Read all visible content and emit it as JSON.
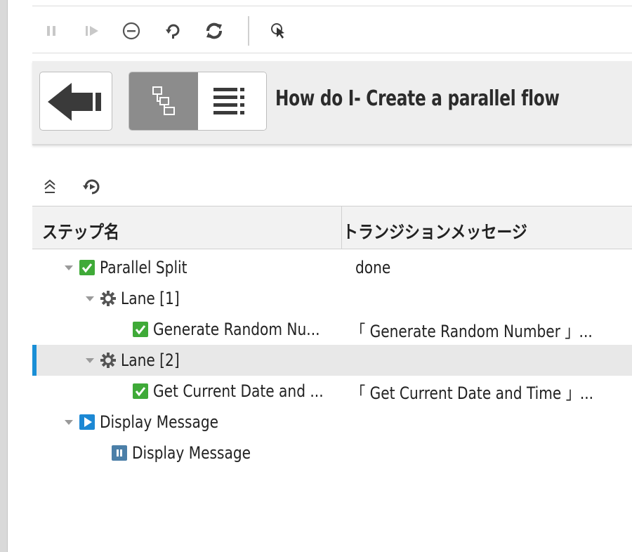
{
  "header": {
    "flow_title": "How do I- Create a parallel flow"
  },
  "toolbar": {
    "buttons": [
      "pause-icon",
      "step-forward-icon",
      "minus-circle-icon",
      "replay-icon",
      "refresh-icon",
      "pointer-icon"
    ]
  },
  "table": {
    "columns": [
      "ステップ名",
      "トランジションメッセージ"
    ],
    "rows": [
      {
        "name": "Parallel Split",
        "message": "done",
        "icon": "check-icon"
      },
      {
        "name": "Lane [1]",
        "message": "",
        "icon": "gear-icon"
      },
      {
        "name": "Generate Random Nu...",
        "message": "「 Generate Random Number 」...",
        "icon": "check-icon"
      },
      {
        "name": "Lane [2]",
        "message": "",
        "icon": "gear-icon"
      },
      {
        "name": "Get Current Date and ...",
        "message": "「 Get Current Date and Time 」...",
        "icon": "check-icon"
      },
      {
        "name": "Display Message",
        "message": "",
        "icon": "play-icon"
      },
      {
        "name": "Display Message",
        "message": "",
        "icon": "paused-icon"
      }
    ]
  },
  "colors": {
    "accent": "#1a8fd6",
    "success": "#3faa38",
    "play": "#1c88d4",
    "paused": "#4b7fa8"
  }
}
